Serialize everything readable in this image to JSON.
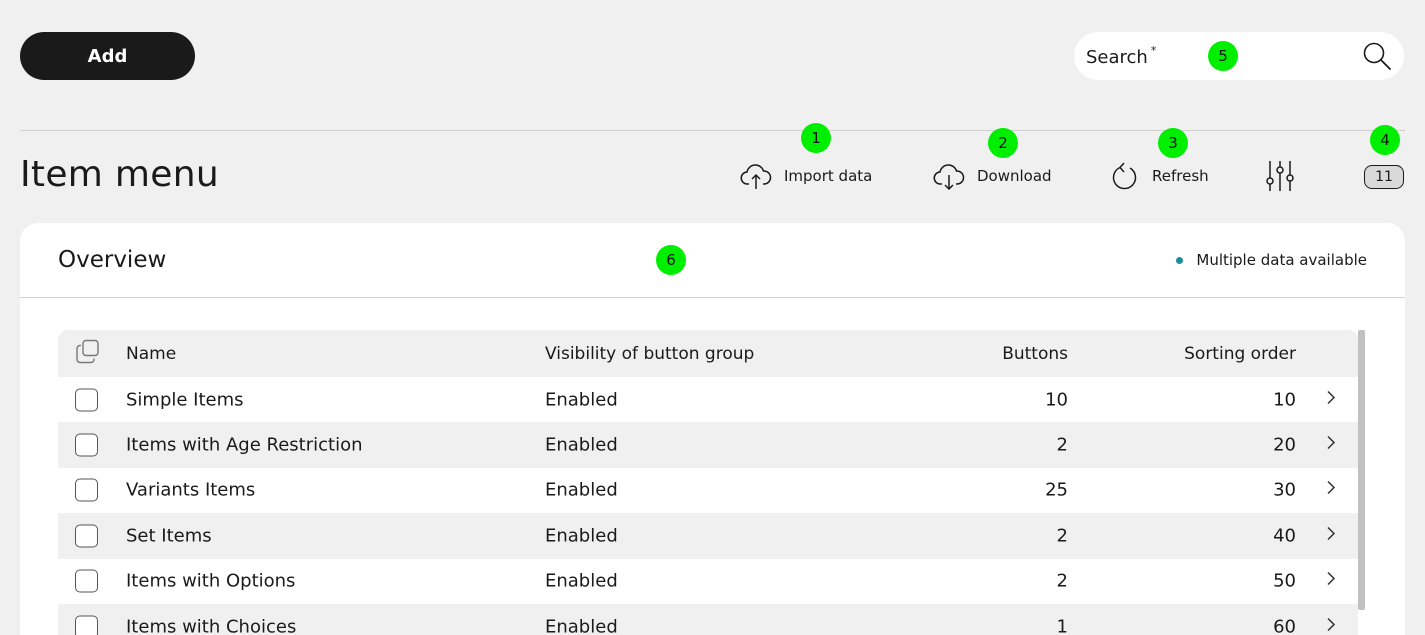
{
  "toolbar": {
    "add_label": "Add",
    "search_label": "Search",
    "search_required": "*",
    "search_value": ""
  },
  "page": {
    "title": "Item menu"
  },
  "actions": {
    "import_label": "Import data",
    "download_label": "Download",
    "refresh_label": "Refresh",
    "count": "11"
  },
  "markers": [
    "1",
    "2",
    "3",
    "4",
    "5",
    "6"
  ],
  "overview": {
    "title": "Overview",
    "status_text": "Multiple data available",
    "status_color": "#1a8fa0"
  },
  "table": {
    "headers": {
      "name": "Name",
      "visibility": "Visibility of button group",
      "buttons": "Buttons",
      "sorting": "Sorting order"
    },
    "rows": [
      {
        "name": "Simple Items",
        "visibility": "Enabled",
        "buttons": "10",
        "sorting": "10"
      },
      {
        "name": "Items with Age Restriction",
        "visibility": "Enabled",
        "buttons": "2",
        "sorting": "20"
      },
      {
        "name": "Variants Items",
        "visibility": "Enabled",
        "buttons": "25",
        "sorting": "30"
      },
      {
        "name": "Set Items",
        "visibility": "Enabled",
        "buttons": "2",
        "sorting": "40"
      },
      {
        "name": "Items with Options",
        "visibility": "Enabled",
        "buttons": "2",
        "sorting": "50"
      },
      {
        "name": "Items with Choices",
        "visibility": "Enabled",
        "buttons": "1",
        "sorting": "60"
      }
    ]
  },
  "icons": {
    "search": "search-icon",
    "import": "cloud-upload-icon",
    "download": "cloud-download-icon",
    "refresh": "refresh-icon",
    "filter": "sliders-icon",
    "select_all": "copy-icon",
    "row_open": "chevron-right-icon"
  },
  "colors": {
    "primary_button": "#1a1a1a",
    "marker": "#00ef00",
    "background": "#f0f0f0"
  }
}
